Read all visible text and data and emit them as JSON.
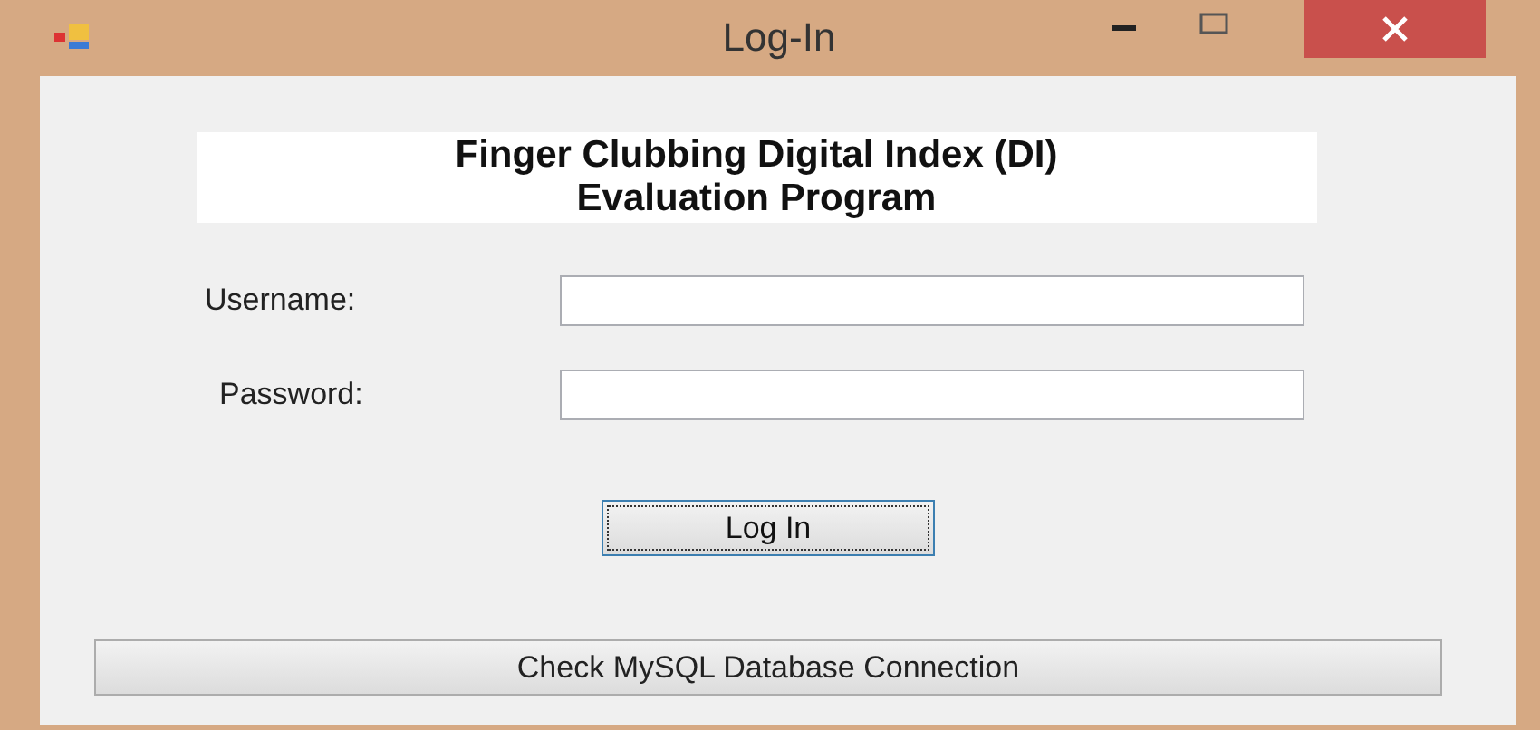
{
  "window": {
    "title": "Log-In"
  },
  "heading": {
    "lines": [
      "Finger Clubbing Digital Index (DI)",
      "Evaluation Program"
    ]
  },
  "fields": [
    {
      "label": "Username:"
    },
    {
      "label": "Password:"
    }
  ],
  "login_button": {
    "label": "Log In",
    "focused": true
  },
  "check_button": {
    "label": "Check MySQL Database Connection"
  }
}
